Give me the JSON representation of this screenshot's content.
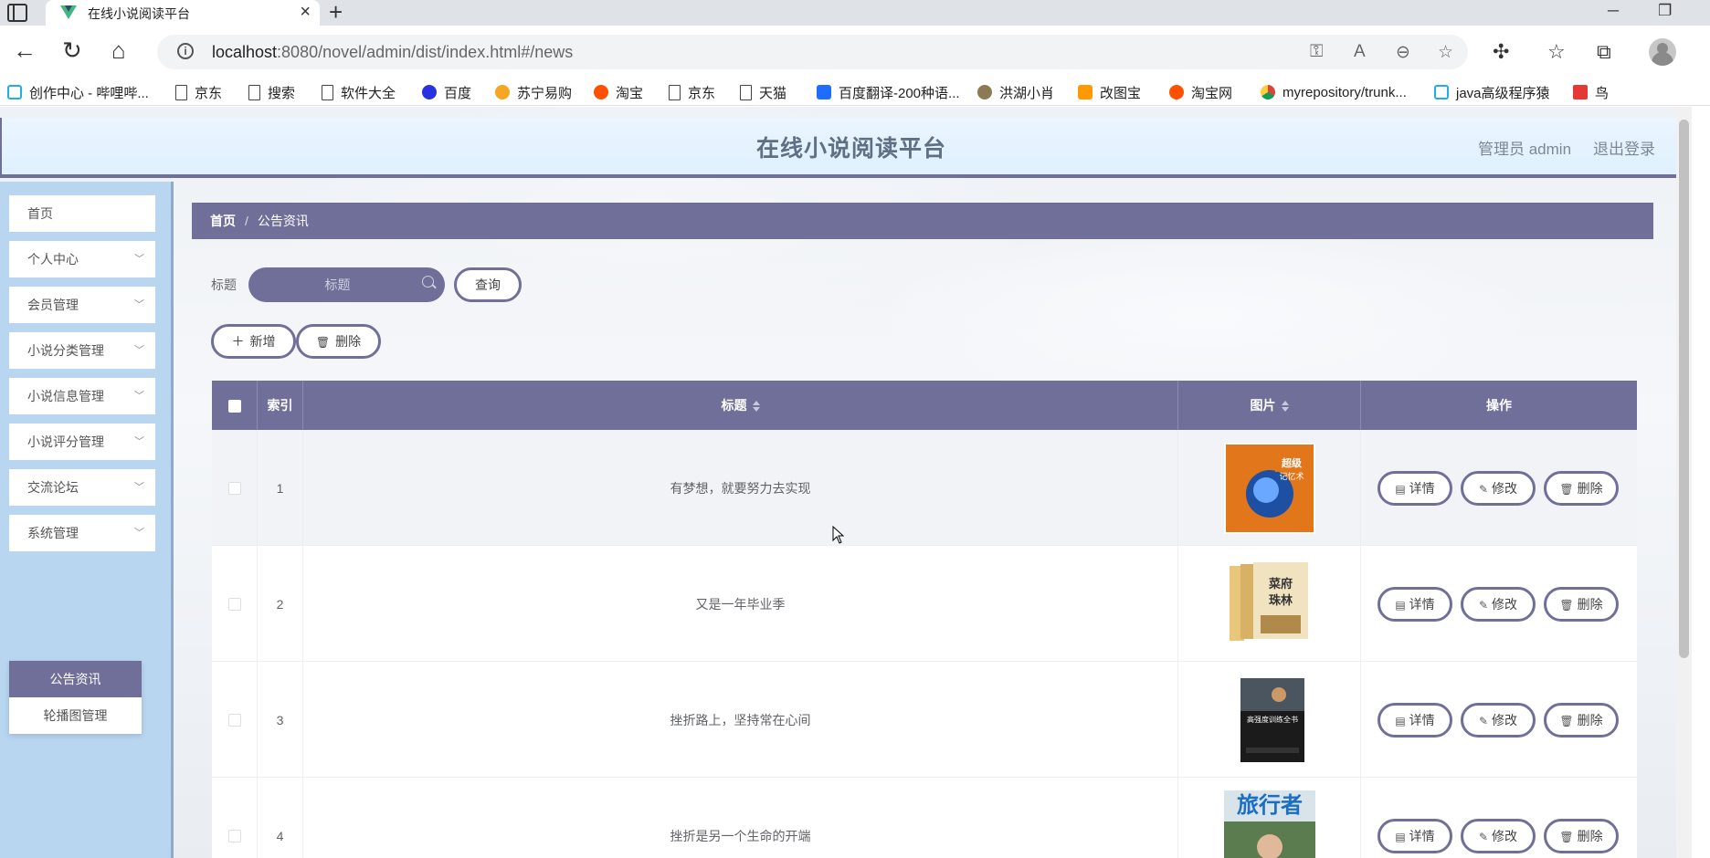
{
  "browser": {
    "tab_title": "在线小说阅读平台",
    "url_host": "localhost",
    "url_rest": ":8080/novel/admin/dist/index.html#/news",
    "bookmarks": [
      {
        "label": "创作中心 - 哔哩哔...",
        "icon": "bilibili"
      },
      {
        "label": "京东",
        "icon": "doc"
      },
      {
        "label": "搜索",
        "icon": "doc"
      },
      {
        "label": "软件大全",
        "icon": "doc"
      },
      {
        "label": "百度",
        "icon": "paw"
      },
      {
        "label": "苏宁易购",
        "icon": "suning"
      },
      {
        "label": "淘宝",
        "icon": "taobao"
      },
      {
        "label": "京东",
        "icon": "doc"
      },
      {
        "label": "天猫",
        "icon": "doc"
      },
      {
        "label": "百度翻译-200种语...",
        "icon": "fanyi"
      },
      {
        "label": "洪湖小肖",
        "icon": "bird"
      },
      {
        "label": "改图宝",
        "icon": "gaitu"
      },
      {
        "label": "淘宝网",
        "icon": "taobao"
      },
      {
        "label": "myrepository/trunk...",
        "icon": "chrome"
      },
      {
        "label": "java高级程序猿",
        "icon": "bilibili"
      },
      {
        "label": "鸟",
        "icon": "ribbon"
      }
    ]
  },
  "header": {
    "title": "在线小说阅读平台",
    "user": "管理员 admin",
    "logout": "退出登录"
  },
  "sidebar": {
    "items": [
      {
        "label": "首页",
        "has_children": false
      },
      {
        "label": "个人中心",
        "has_children": true
      },
      {
        "label": "会员管理",
        "has_children": true
      },
      {
        "label": "小说分类管理",
        "has_children": true
      },
      {
        "label": "小说信息管理",
        "has_children": true
      },
      {
        "label": "小说评分管理",
        "has_children": true
      },
      {
        "label": "交流论坛",
        "has_children": true
      },
      {
        "label": "系统管理",
        "has_children": true
      }
    ],
    "submenu": [
      {
        "label": "公告资讯",
        "active": true
      },
      {
        "label": "轮播图管理",
        "active": false
      }
    ]
  },
  "breadcrumb": {
    "home": "首页",
    "current": "公告资讯"
  },
  "search": {
    "label": "标题",
    "placeholder": "标题",
    "button": "查询"
  },
  "actions": {
    "add": "新增",
    "delete": "删除"
  },
  "table": {
    "columns": {
      "index": "索引",
      "title": "标题",
      "image": "图片",
      "ops": "操作"
    },
    "row_buttons": {
      "detail": "详情",
      "edit": "修改",
      "delete": "删除"
    },
    "rows": [
      {
        "index": "1",
        "title": "有梦想，就要努力去实现",
        "cover": "超级记忆术"
      },
      {
        "index": "2",
        "title": "又是一年毕业季",
        "cover": "菜府珠林"
      },
      {
        "index": "3",
        "title": "挫折路上，坚持常在心间",
        "cover": "高强度训练全书"
      },
      {
        "index": "4",
        "title": "挫折是另一个生命的开端",
        "cover": "旅行者"
      }
    ]
  },
  "colors": {
    "accent": "#6f6f99",
    "header_bg": "#e0f0ff",
    "sidebar_bg": "#b9d6f1"
  }
}
